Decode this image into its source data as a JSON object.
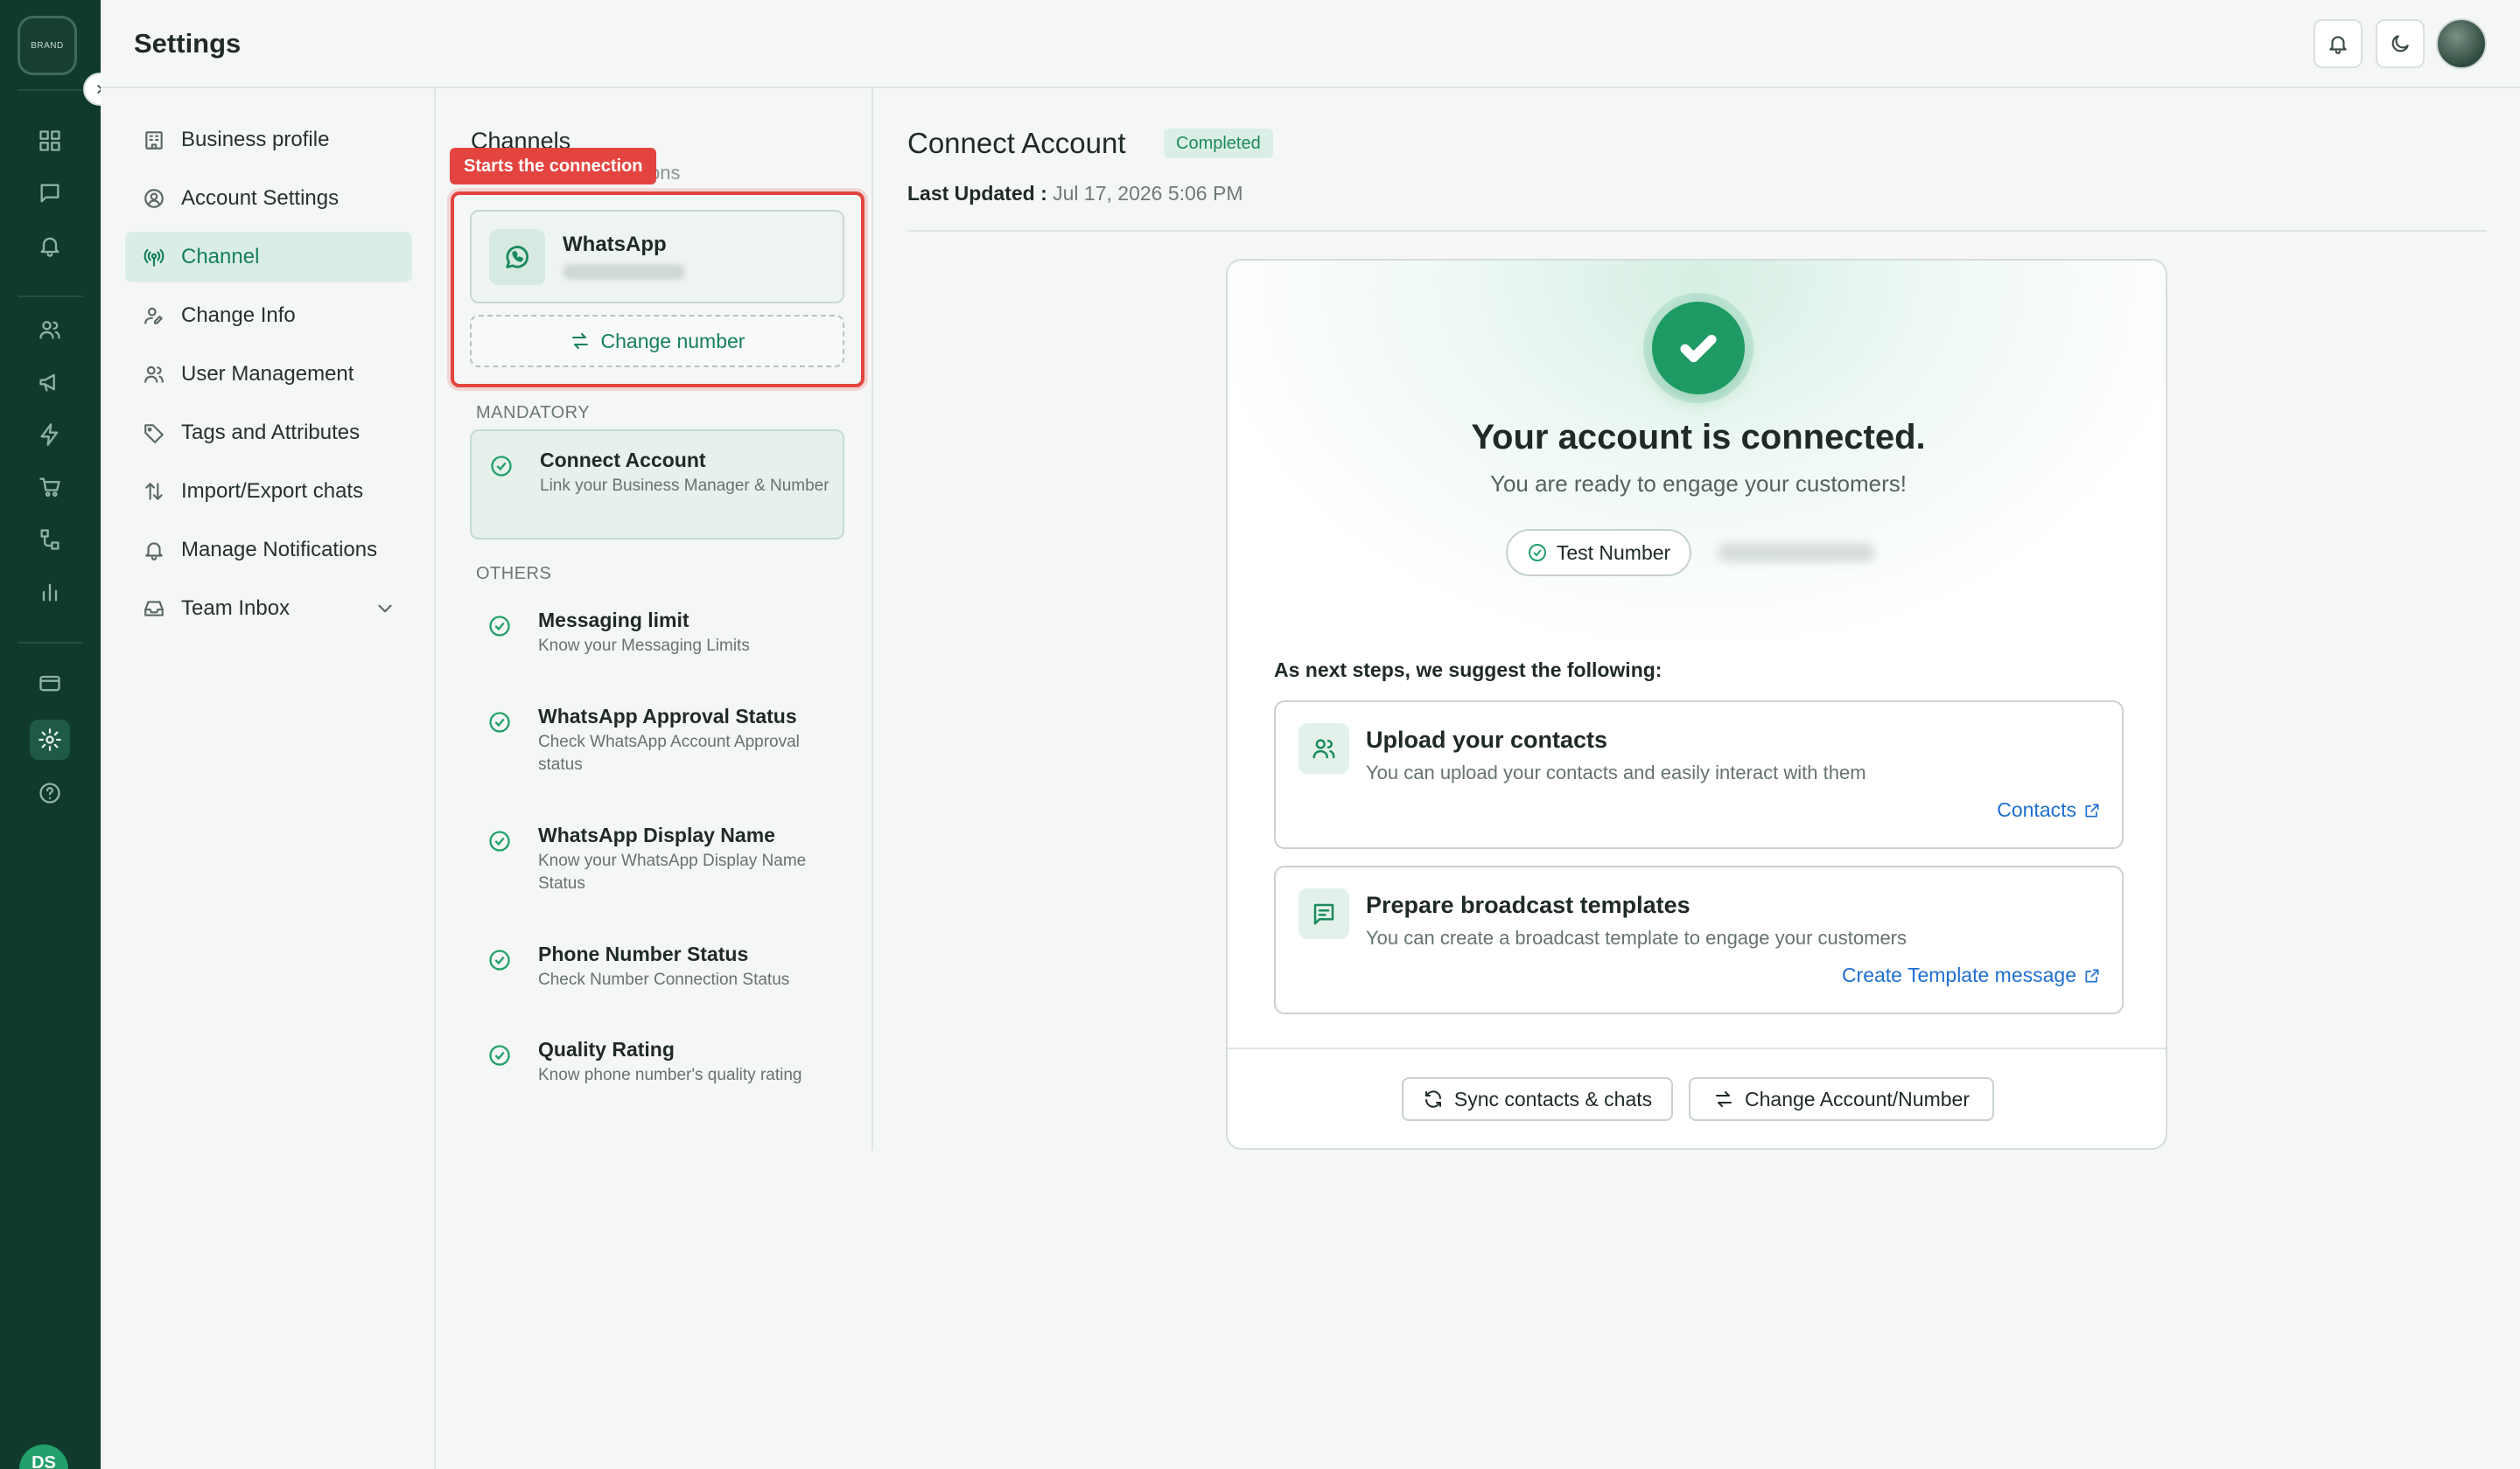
{
  "rail": {
    "logo_text": "BRAND",
    "avatar_initials": "DS",
    "icons": [
      "dashboard-icon",
      "chat-icon",
      "bell-icon",
      "users-icon",
      "megaphone-icon",
      "bolt-icon",
      "cart-icon",
      "flow-icon",
      "chart-icon",
      "card-icon",
      "settings-icon",
      "help-icon"
    ],
    "active": "settings-icon"
  },
  "header": {
    "title": "Settings"
  },
  "settings_nav": {
    "items": [
      {
        "label": "Business profile",
        "icon": "building-icon"
      },
      {
        "label": "Account Settings",
        "icon": "user-circle-icon"
      },
      {
        "label": "Channel",
        "icon": "broadcast-icon",
        "active": true
      },
      {
        "label": "Change Info",
        "icon": "user-edit-icon"
      },
      {
        "label": "User Management",
        "icon": "users-icon"
      },
      {
        "label": "Tags and Attributes",
        "icon": "tag-icon"
      },
      {
        "label": "Import/Export chats",
        "icon": "arrows-updown-icon"
      },
      {
        "label": "Manage Notifications",
        "icon": "bell-icon"
      },
      {
        "label": "Team Inbox",
        "icon": "inbox-icon"
      }
    ]
  },
  "channels": {
    "title": "Channels",
    "subtitle": "ctions",
    "tooltip": "Starts the connection",
    "whatsapp": {
      "name": "WhatsApp"
    },
    "change_number": "Change number",
    "mandatory_label": "MANDATORY",
    "mandatory": [
      {
        "title": "Connect Account",
        "desc": "Link your Business Manager & Number"
      }
    ],
    "others_label": "OTHERS",
    "others": [
      {
        "title": "Messaging limit",
        "desc": "Know your Messaging Limits"
      },
      {
        "title": "WhatsApp Approval Status",
        "desc": "Check WhatsApp Account Approval status"
      },
      {
        "title": "WhatsApp Display Name",
        "desc": "Know your WhatsApp Display Name Status"
      },
      {
        "title": "Phone Number Status",
        "desc": "Check Number Connection Status"
      },
      {
        "title": "Quality Rating",
        "desc": "Know phone number's quality rating"
      }
    ]
  },
  "main": {
    "title": "Connect Account",
    "badge": "Completed",
    "last_updated_label": "Last Updated :",
    "last_updated_value": "Jul 17, 2026 5:06 PM",
    "colors": {
      "accent": "#1e9b64",
      "link": "#1f6fd1",
      "highlight": "#e4443f"
    },
    "card": {
      "heading": "Your account is connected.",
      "subheading": "You are ready to engage your customers!",
      "test_number": "Test Number",
      "next_steps": "As next steps, we suggest the following:",
      "suggestions": [
        {
          "title": "Upload your contacts",
          "desc": "You can upload your contacts and easily interact with them",
          "link": "Contacts",
          "icon": "users-icon"
        },
        {
          "title": "Prepare broadcast templates",
          "desc": "You can create a broadcast template to engage your customers",
          "link": "Create Template message",
          "icon": "message-icon"
        }
      ],
      "sync_button": "Sync contacts & chats",
      "change_button": "Change Account/Number"
    }
  }
}
